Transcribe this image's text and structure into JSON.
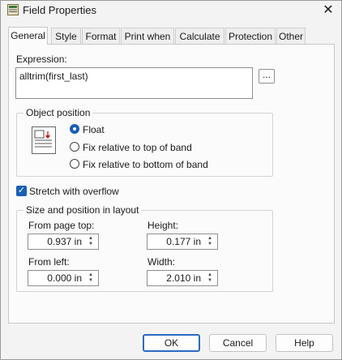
{
  "window": {
    "title": "Field Properties",
    "icon": "properties-icon",
    "close_icon": "close-icon"
  },
  "tabs": [
    "General",
    "Style",
    "Format",
    "Print when",
    "Calculate",
    "Protection",
    "Other"
  ],
  "active_tab": "General",
  "expression": {
    "label": "Expression:",
    "value": "alltrim(first_last)",
    "browse_label": "..."
  },
  "object_position": {
    "title": "Object position",
    "options": [
      {
        "label": "Float",
        "selected": true
      },
      {
        "label": "Fix relative to top of band",
        "selected": false
      },
      {
        "label": "Fix relative to bottom of band",
        "selected": false
      }
    ]
  },
  "stretch": {
    "label": "Stretch with overflow",
    "checked": true
  },
  "size_position": {
    "title": "Size and position in layout",
    "from_page_top": {
      "label": "From page top:",
      "value": "0.937 in"
    },
    "height": {
      "label": "Height:",
      "value": "0.177 in"
    },
    "from_left": {
      "label": "From left:",
      "value": "0.000 in"
    },
    "width": {
      "label": "Width:",
      "value": "2.010 in"
    }
  },
  "buttons": {
    "ok": "OK",
    "cancel": "Cancel",
    "help": "Help"
  },
  "colors": {
    "accent": "#1a5fb4",
    "background": "#f3f3f3",
    "panel": "#fbfbfb"
  }
}
